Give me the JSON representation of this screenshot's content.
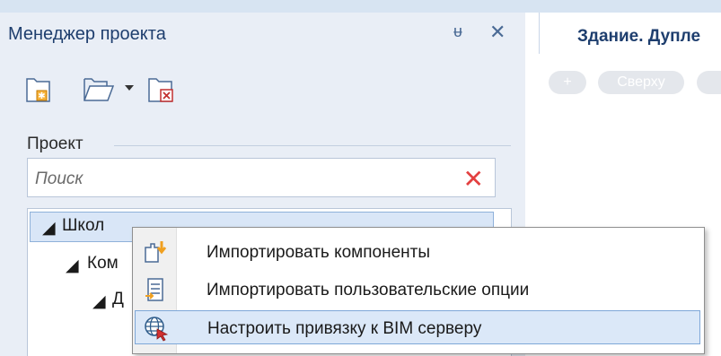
{
  "panel": {
    "title": "Менеджер проекта",
    "pin_icon": "pin-icon",
    "close_icon": "close-icon"
  },
  "document_tab": {
    "label": "Здание. Дупле"
  },
  "view_pills": [
    {
      "label": "+"
    },
    {
      "label": "Сверху"
    }
  ],
  "toolbar": {
    "icons": [
      "new-folder-icon",
      "open-folder-icon",
      "dropdown-arrow-icon",
      "delete-folder-icon"
    ]
  },
  "project_group": {
    "label": "Проект"
  },
  "search": {
    "placeholder": "Поиск",
    "clear_icon": "clear-icon"
  },
  "tree": {
    "items": [
      {
        "label": "Школ"
      },
      {
        "label": "Ком"
      },
      {
        "label": "Д"
      }
    ]
  },
  "context_menu": {
    "items": [
      {
        "label": "Импортировать компоненты",
        "icon": "import-components-icon"
      },
      {
        "label": "Импортировать пользовательские опции",
        "icon": "import-options-icon"
      },
      {
        "label": "Настроить привязку к BIM серверу",
        "icon": "bim-server-icon"
      }
    ]
  }
}
